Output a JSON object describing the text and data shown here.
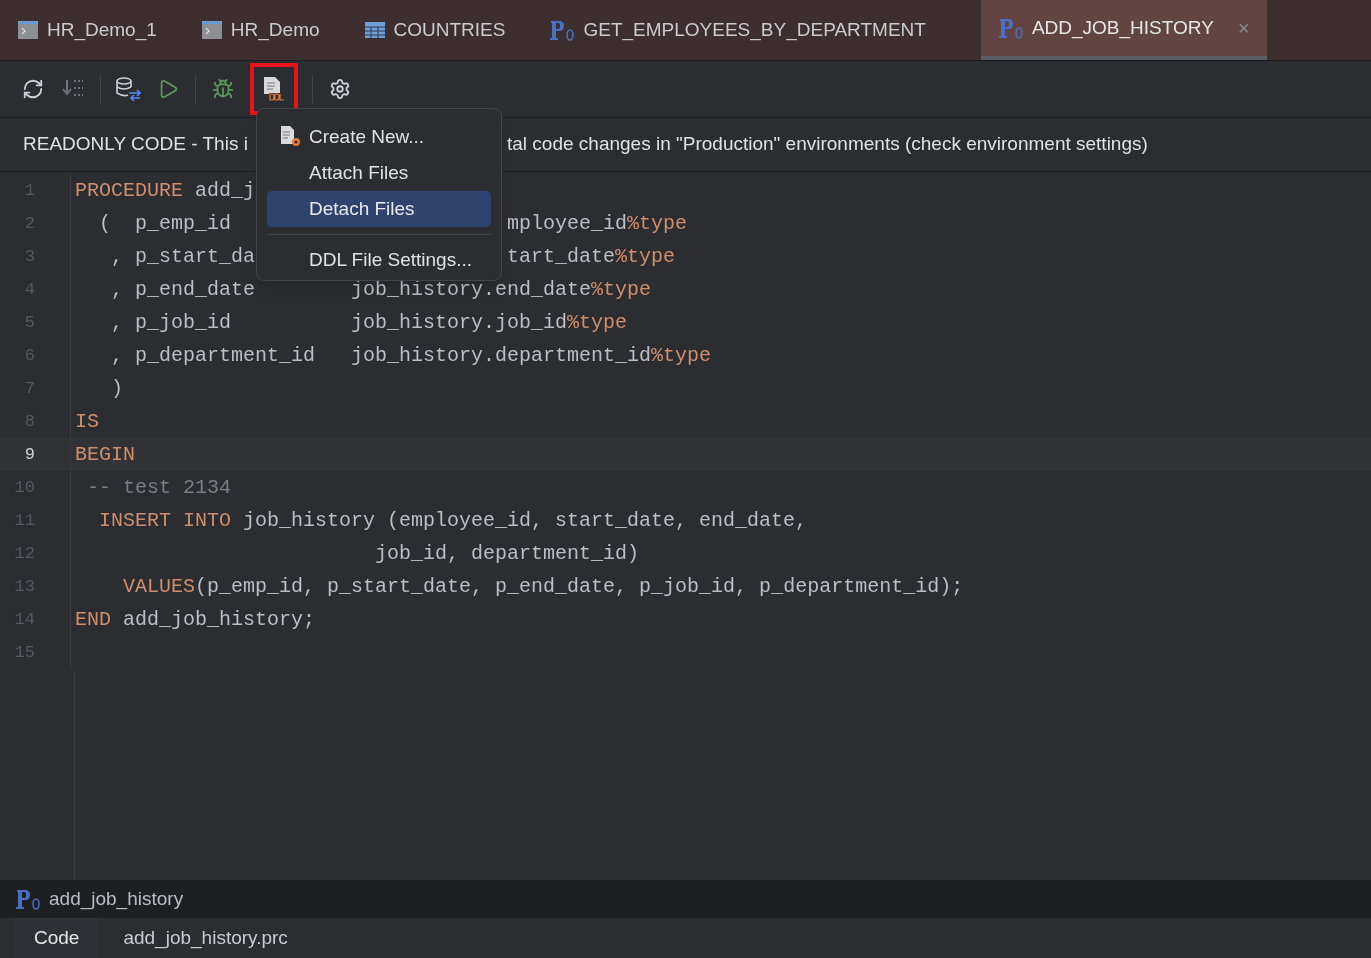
{
  "tabs": [
    {
      "kind": "console",
      "label": "HR_Demo_1",
      "selected": false
    },
    {
      "kind": "console",
      "label": "HR_Demo",
      "selected": false
    },
    {
      "kind": "table",
      "label": "COUNTRIES",
      "selected": false
    },
    {
      "kind": "procedure",
      "label": "GET_EMPLOYEES_BY_DEPARTMENT",
      "selected": false
    },
    {
      "kind": "procedure",
      "label": "ADD_JOB_HISTORY",
      "selected": true,
      "close": "×"
    }
  ],
  "toolbar": [
    {
      "kind": "refresh",
      "highlighted": false,
      "disabled": false
    },
    {
      "kind": "binary",
      "highlighted": false,
      "disabled": true
    },
    {
      "kind": "database",
      "highlighted": false,
      "disabled": false
    },
    {
      "kind": "run",
      "highlighted": false,
      "disabled": false
    },
    {
      "kind": "debug",
      "highlighted": false,
      "disabled": false
    },
    {
      "kind": "ddl",
      "highlighted": true,
      "disabled": false
    },
    {
      "kind": "settings",
      "highlighted": false,
      "disabled": false
    }
  ],
  "banner": {
    "left": "READONLY CODE - This i",
    "right": "tal code changes in \"Production\" environments (check environment settings)"
  },
  "code": [
    {
      "number": "1",
      "current": false,
      "tokens": [
        {
          "kind": "keyword",
          "text": "PROCEDURE"
        },
        {
          "kind": "text",
          "text": " add_j"
        }
      ]
    },
    {
      "number": "2",
      "current": false,
      "tokens": [
        {
          "kind": "text",
          "text": "  (  p_emp_id"
        }
      ],
      "tail": [
        {
          "kind": "text",
          "text": "mployee_id"
        },
        {
          "kind": "keyword",
          "text": "%type"
        }
      ]
    },
    {
      "number": "3",
      "current": false,
      "tokens": [
        {
          "kind": "text",
          "text": "   , p_start_da"
        }
      ],
      "tail": [
        {
          "kind": "text",
          "text": "tart_date"
        },
        {
          "kind": "keyword",
          "text": "%type"
        }
      ]
    },
    {
      "number": "4",
      "current": false,
      "tokens": [
        {
          "kind": "text",
          "text": "   , p_end_date        job_history.end_date"
        },
        {
          "kind": "keyword",
          "text": "%type"
        }
      ]
    },
    {
      "number": "5",
      "current": false,
      "tokens": [
        {
          "kind": "text",
          "text": "   , p_job_id          job_history.job_id"
        },
        {
          "kind": "keyword",
          "text": "%type"
        }
      ]
    },
    {
      "number": "6",
      "current": false,
      "tokens": [
        {
          "kind": "text",
          "text": "   , p_department_id   job_history.department_id"
        },
        {
          "kind": "keyword",
          "text": "%type"
        }
      ]
    },
    {
      "number": "7",
      "current": false,
      "tokens": [
        {
          "kind": "text",
          "text": "   )"
        }
      ]
    },
    {
      "number": "8",
      "current": false,
      "tokens": [
        {
          "kind": "keyword",
          "text": "IS"
        }
      ]
    },
    {
      "number": "9",
      "current": true,
      "tokens": [
        {
          "kind": "keyword",
          "text": "BEGIN"
        }
      ]
    },
    {
      "number": "10",
      "current": false,
      "tokens": [
        {
          "kind": "comment",
          "text": " -- test 2134"
        }
      ]
    },
    {
      "number": "11",
      "current": false,
      "tokens": [
        {
          "kind": "keyword",
          "text": "  INSERT INTO"
        },
        {
          "kind": "text",
          "text": " job_history (employee_id, start_date, end_date,"
        }
      ]
    },
    {
      "number": "12",
      "current": false,
      "tokens": [
        {
          "kind": "text",
          "text": "                         job_id, department_id)"
        }
      ]
    },
    {
      "number": "13",
      "current": false,
      "tokens": [
        {
          "kind": "keyword",
          "text": "    VALUES"
        },
        {
          "kind": "text",
          "text": "(p_emp_id, p_start_date, p_end_date, p_job_id, p_department_id);"
        }
      ]
    },
    {
      "number": "14",
      "current": false,
      "tokens": [
        {
          "kind": "keyword",
          "text": "END"
        },
        {
          "kind": "text",
          "text": " add_job_history;"
        }
      ]
    },
    {
      "number": "15",
      "current": false
    }
  ],
  "menu": [
    {
      "label": "Create New...",
      "kind": "new-file",
      "selected": false
    },
    {
      "label": "Attach Files",
      "kind": "plain",
      "selected": false
    },
    {
      "label": "Detach Files",
      "kind": "plain",
      "selected": true
    },
    {
      "kind": "separator"
    },
    {
      "label": "DDL File Settings...",
      "kind": "plain",
      "selected": false
    }
  ],
  "breadcrumb": {
    "kind": "procedure",
    "label": "add_job_history"
  },
  "bottom_tabs": [
    {
      "label": "Code",
      "selected": true
    },
    {
      "label": "add_job_history.prc",
      "selected": false
    }
  ]
}
